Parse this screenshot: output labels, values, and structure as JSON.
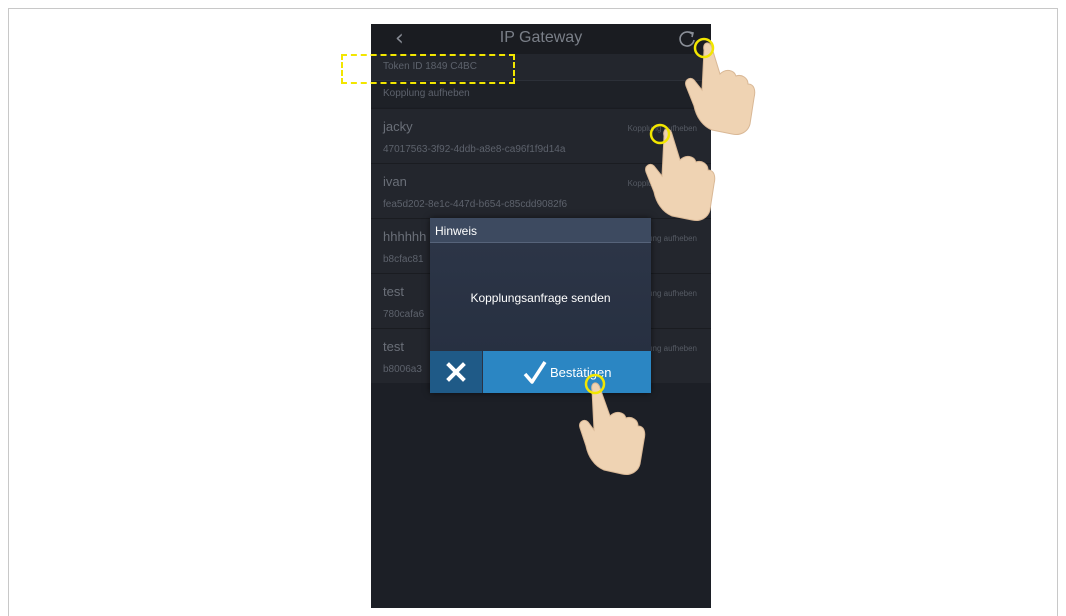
{
  "app": {
    "title": "IP Gateway",
    "token_label": "Token ID 1849 C4BC",
    "unpair_all_label": "Kopplung aufheben"
  },
  "devices": [
    {
      "name": "jacky",
      "uuid": "47017563-3f92-4ddb-a8e8-ca96f1f9d14a",
      "action": "Kopplung aufheben"
    },
    {
      "name": "ivan",
      "uuid": "fea5d202-8e1c-447d-b654-c85cdd9082f6",
      "action": "Kopplung aufheben"
    },
    {
      "name": "hhhhhh",
      "uuid": "b8cfac81",
      "action": "Kopplung aufheben"
    },
    {
      "name": "test",
      "uuid": "780cafa6",
      "action": "Kopplung aufheben"
    },
    {
      "name": "test",
      "uuid": "b8006a3",
      "action": "Kopplung aufheben"
    }
  ],
  "dialog": {
    "title": "Hinweis",
    "message": "Kopplungsanfrage senden",
    "confirm_label": "Bestätigen"
  },
  "colors": {
    "highlight": "#f2e600",
    "confirm_button": "#2b86c3",
    "cancel_button": "#1f5a87"
  },
  "icons": [
    "back-chevron-icon",
    "refresh-icon",
    "close-icon",
    "checkmark-icon",
    "pointing-hand-icon"
  ]
}
